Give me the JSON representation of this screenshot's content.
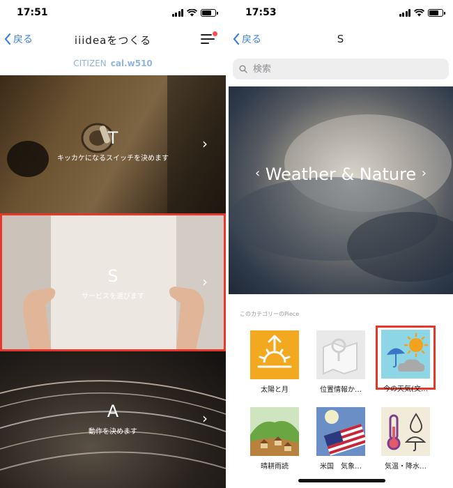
{
  "left": {
    "status_time": "17:51",
    "back_label": "戻る",
    "title": "iiideaをつくる",
    "device_brand": "CITIZEN",
    "device_model": "cal.w510",
    "cards": [
      {
        "letter": "T",
        "subtitle": "キッカケになるスイッチを決めます"
      },
      {
        "letter": "S",
        "subtitle": "サービスを選びます"
      },
      {
        "letter": "A",
        "subtitle": "動作を決めます"
      }
    ]
  },
  "right": {
    "status_time": "17:53",
    "back_label": "戻る",
    "title": "S",
    "search_placeholder": "検索",
    "hero_title": "Weather & Nature",
    "section_label": "このカテゴリーのPiece",
    "pieces": [
      {
        "name": "太陽と月",
        "icon": "sunrise-icon"
      },
      {
        "name": "位置情報か…",
        "icon": "map-pin-icon"
      },
      {
        "name": "今の天気(文…",
        "icon": "weather-icon"
      },
      {
        "name": "晴耕雨読",
        "icon": "village-icon"
      },
      {
        "name": "米国　気象…",
        "icon": "us-flag-icon"
      },
      {
        "name": "気温・降水…",
        "icon": "thermometer-icon"
      }
    ]
  },
  "colors": {
    "accent": "#3e83d6",
    "highlight": "#e6372a",
    "sunrise_tile": "#f2a91f"
  }
}
